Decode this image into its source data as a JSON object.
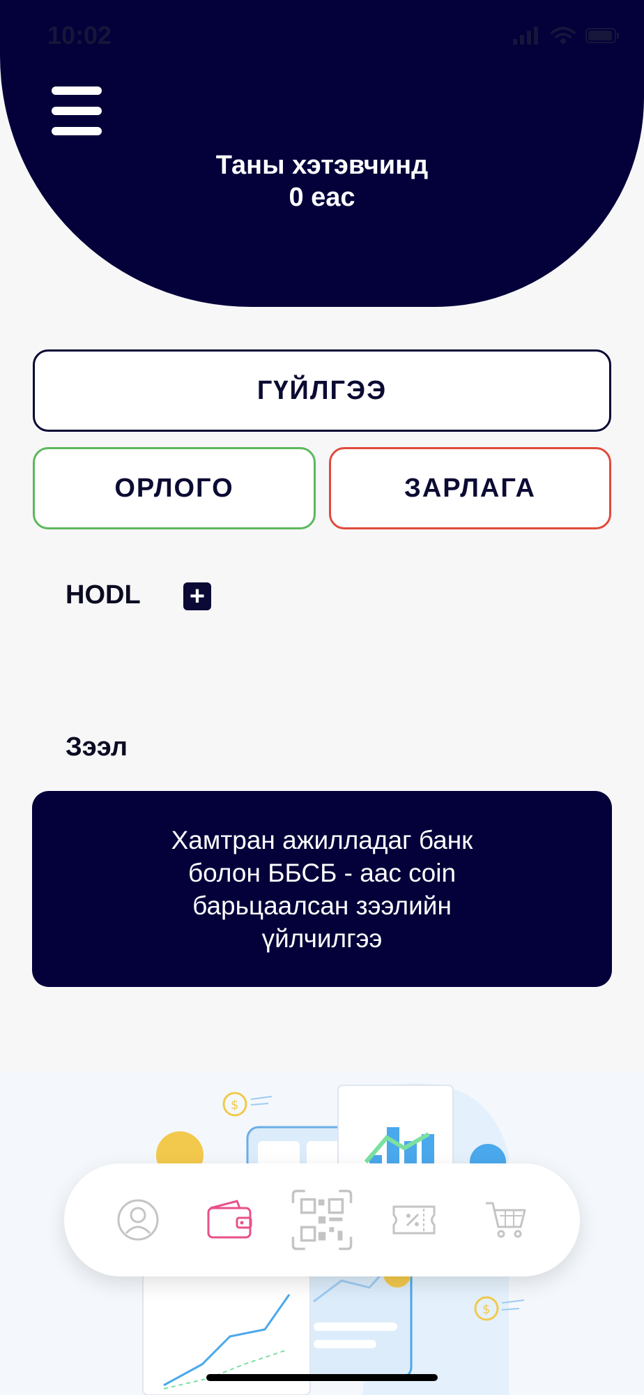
{
  "status_bar": {
    "time": "10:02"
  },
  "header": {
    "menu_icon": "hamburger-menu-icon",
    "wallet_label": "Таны хэтэвчинд",
    "wallet_balance": "0 eac"
  },
  "actions": {
    "transaction_label": "ГҮЙЛГЭЭ",
    "income_label": "ОРЛОГО",
    "expense_label": "ЗАРЛАГА",
    "colors": {
      "income_border": "#5cb85c",
      "expense_border": "#e04a3b",
      "primary": "#03003a"
    }
  },
  "hodl": {
    "title": "HODL",
    "add_icon": "plus-icon"
  },
  "loan": {
    "title": "Зээл",
    "card_text": "Хамтран ажилладаг банк болон ББСБ - аас coin барьцаалсан зээлийн үйлчилгээ"
  },
  "bottom_nav": {
    "items": [
      {
        "icon": "profile-icon",
        "active": false
      },
      {
        "icon": "wallet-icon",
        "active": true
      },
      {
        "icon": "qr-code-icon",
        "active": false
      },
      {
        "icon": "coupon-icon",
        "active": false
      },
      {
        "icon": "cart-icon",
        "active": false
      }
    ],
    "active_color": "#e8508a",
    "inactive_color": "#c4c4c4"
  }
}
